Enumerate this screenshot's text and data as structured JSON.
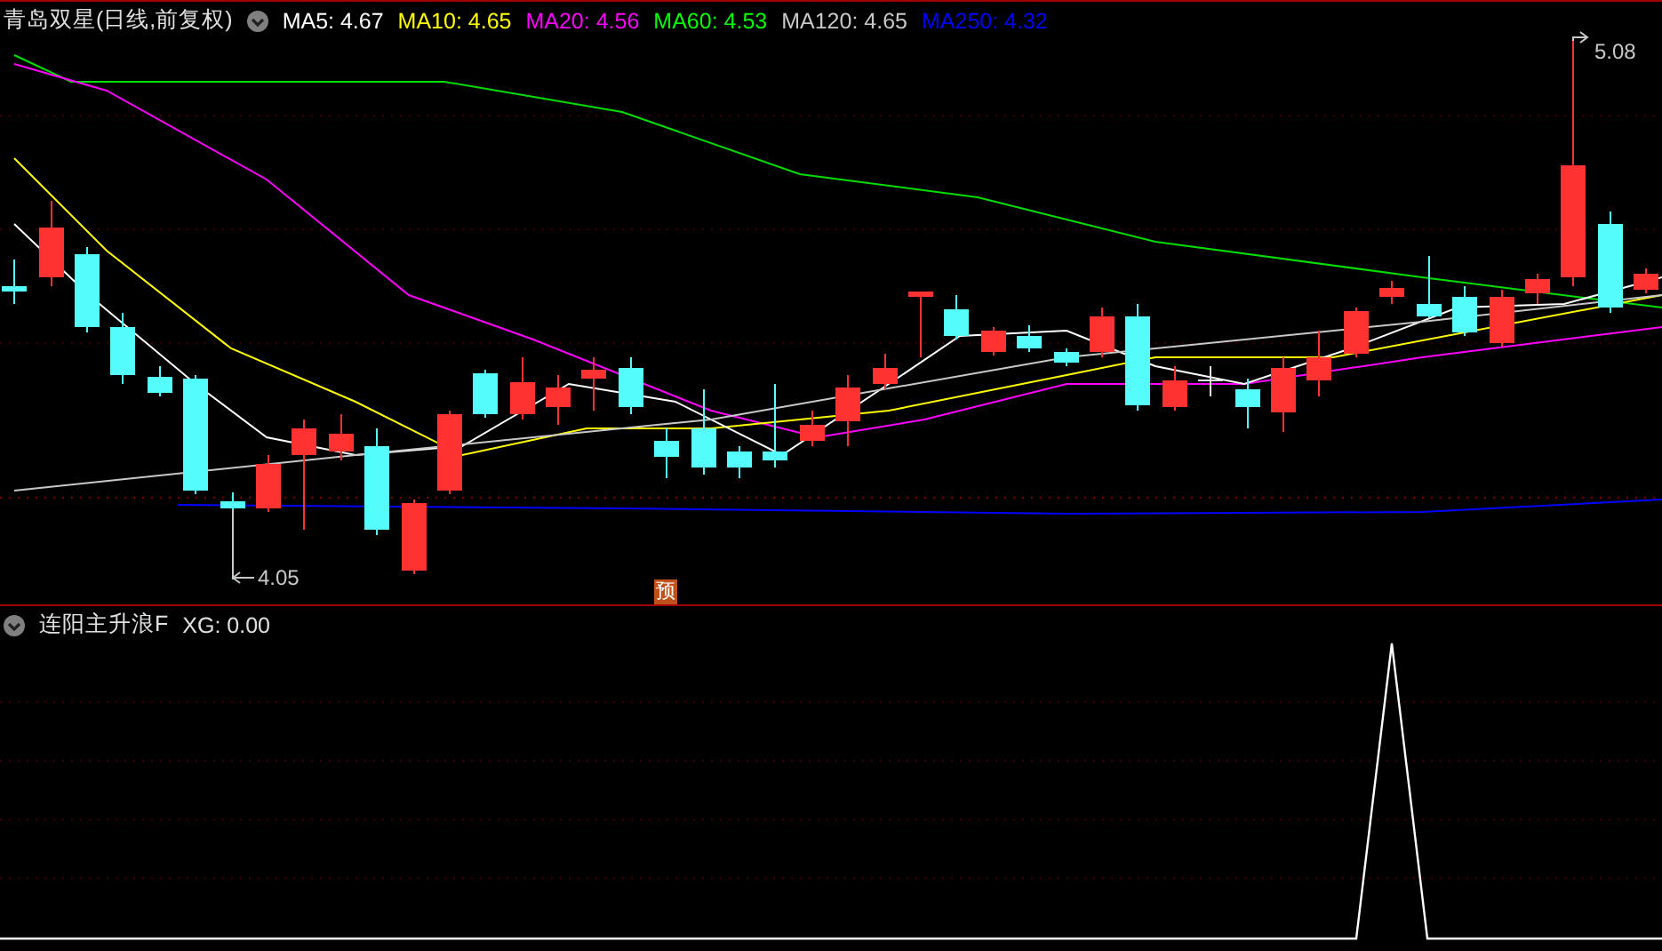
{
  "title": "青岛双星(日线,前复权)",
  "ma_legend": [
    {
      "label": "MA5: 4.67",
      "color": "#ffffff"
    },
    {
      "label": "MA10: 4.65",
      "color": "#ffff00"
    },
    {
      "label": "MA20: 4.56",
      "color": "#ff00ff"
    },
    {
      "label": "MA60: 4.53",
      "color": "#00ff00"
    },
    {
      "label": "MA120: 4.65",
      "color": "#c8c8c8"
    },
    {
      "label": "MA250: 4.32",
      "color": "#0000ff"
    }
  ],
  "price_annotations": [
    {
      "text": "5.08"
    },
    {
      "text": "4.05"
    }
  ],
  "forecast_badge": "预",
  "indicator": {
    "name": "连阳主升浪F",
    "reading": "XG: 0.00"
  }
}
